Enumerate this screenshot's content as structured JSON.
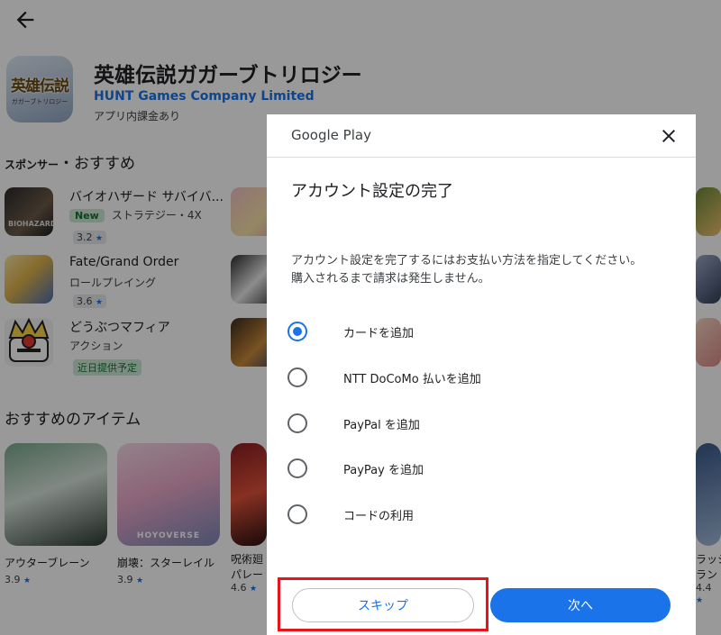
{
  "app": {
    "title": "英雄伝説ガガーブトリロジー",
    "developer": "HUNT Games Company Limited",
    "iap_note": "アプリ内課金あり",
    "icon_text": "英雄伝説",
    "icon_subtext": "ガガーブトリロジー"
  },
  "sponsored": {
    "title_prefix": "スポンサー",
    "title_rest": "・おすすめ",
    "items": [
      {
        "name": "バイオハザード サバイバ...",
        "badge": "New",
        "category": "ストラテジー・4X",
        "rating": "3.2"
      },
      {
        "name": "Fate/Grand Order",
        "category": "ロールプレイング",
        "rating": "3.6"
      },
      {
        "name": "どうぶつマフィア",
        "category": "アクション",
        "status_badge": "近日提供予定"
      }
    ]
  },
  "recommended": {
    "title": "おすすめのアイテム",
    "items": [
      {
        "name": "アウターブレーン",
        "rating": "3.9"
      },
      {
        "name": "崩壊：スターレイル",
        "rating": "3.9"
      },
      {
        "name": "呪術廻",
        "name2": "パレー",
        "rating": "4.6"
      },
      {
        "name": "ラッシ",
        "name2": "ラン",
        "rating": "4.4"
      }
    ]
  },
  "dialog": {
    "brand": "Google Play",
    "title": "アカウント設定の完了",
    "body_line1": "アカウント設定を完了するにはお支払い方法を指定してください。",
    "body_line2": "購入されるまで請求は発生しません。",
    "options": [
      {
        "label": "カードを追加",
        "selected": true
      },
      {
        "label": "NTT DoCoMo 払いを追加",
        "selected": false
      },
      {
        "label": "PayPal を追加",
        "selected": false
      },
      {
        "label": "PayPay を追加",
        "selected": false
      },
      {
        "label": "コードの利用",
        "selected": false
      }
    ],
    "skip_label": "スキップ",
    "next_label": "次へ"
  },
  "colors": {
    "accent": "#1a73e8",
    "highlight": "#e8141b",
    "scrim": "rgba(0,0,0,0.40)"
  }
}
